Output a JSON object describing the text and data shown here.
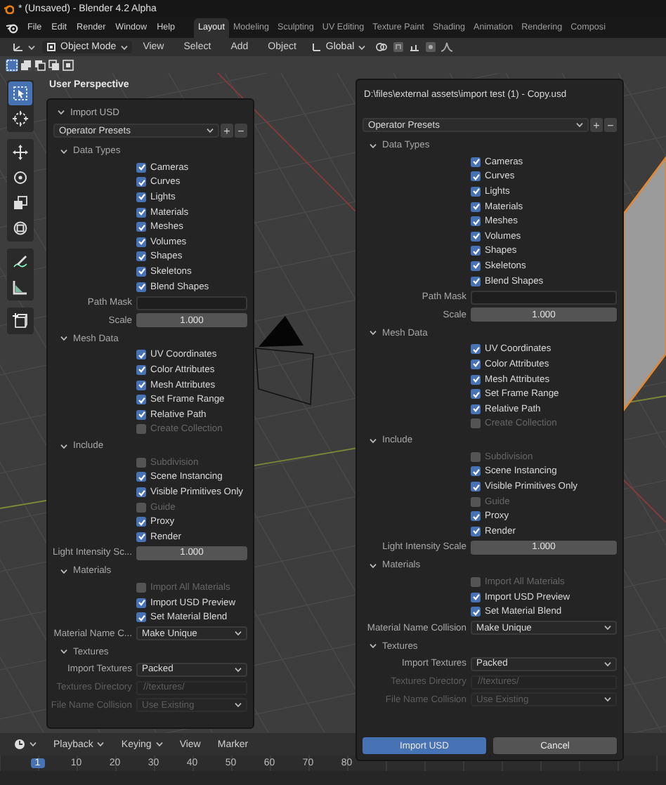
{
  "title_bar": {
    "title": "* (Unsaved) - Blender 4.2 Alpha"
  },
  "menu": [
    "File",
    "Edit",
    "Render",
    "Window",
    "Help"
  ],
  "workspaces": [
    {
      "label": "Layout",
      "selected": true
    },
    {
      "label": "Modeling",
      "selected": false
    },
    {
      "label": "Sculpting",
      "selected": false
    },
    {
      "label": "UV Editing",
      "selected": false
    },
    {
      "label": "Texture Paint",
      "selected": false
    },
    {
      "label": "Shading",
      "selected": false
    },
    {
      "label": "Animation",
      "selected": false
    },
    {
      "label": "Rendering",
      "selected": false
    },
    {
      "label": "Composi",
      "selected": false
    }
  ],
  "header": {
    "mode": "Object Mode",
    "menus": [
      "View",
      "Select",
      "Add",
      "Object"
    ],
    "orientation": "Global"
  },
  "select_modes": [
    {
      "kind": "new",
      "selected": true
    },
    {
      "kind": "extend",
      "selected": false
    },
    {
      "kind": "subtract",
      "selected": false
    },
    {
      "kind": "invert",
      "selected": false
    },
    {
      "kind": "intersect",
      "selected": false
    }
  ],
  "viewport": {
    "label": "User Perspective"
  },
  "tools": [
    {
      "kind": "select",
      "selected": true
    },
    {
      "kind": "cursor",
      "selected": false
    },
    {
      "kind": "move",
      "selected": false
    },
    {
      "kind": "rotate",
      "selected": false
    },
    {
      "kind": "scale",
      "selected": false
    },
    {
      "kind": "transform",
      "selected": false
    },
    {
      "kind": "annotate",
      "selected": false
    },
    {
      "kind": "measure",
      "selected": false
    },
    {
      "kind": "add-cube",
      "selected": false
    }
  ],
  "panels": [
    {
      "header": {
        "kind": "collapsible",
        "text": "Import USD",
        "expanded": true
      },
      "presets": "Operator Presets",
      "preset_buttons": [
        "+",
        "−"
      ],
      "sections": [
        {
          "title": "Data Types",
          "expanded": true,
          "rows": [
            {
              "kind": "check",
              "label": "Cameras",
              "checked": true,
              "disabled": false
            },
            {
              "kind": "check",
              "label": "Curves",
              "checked": true,
              "disabled": false
            },
            {
              "kind": "check",
              "label": "Lights",
              "checked": true,
              "disabled": false
            },
            {
              "kind": "check",
              "label": "Materials",
              "checked": true,
              "disabled": false
            },
            {
              "kind": "check",
              "label": "Meshes",
              "checked": true,
              "disabled": false
            },
            {
              "kind": "check",
              "label": "Volumes",
              "checked": true,
              "disabled": false
            },
            {
              "kind": "check",
              "label": "Shapes",
              "checked": true,
              "disabled": false
            },
            {
              "kind": "check",
              "label": "Skeletons",
              "checked": true,
              "disabled": false
            },
            {
              "kind": "check",
              "label": "Blend Shapes",
              "checked": true,
              "disabled": false
            },
            {
              "kind": "field",
              "label": "Path Mask",
              "disabled": false
            },
            {
              "kind": "number",
              "label": "Scale",
              "value": "1.000",
              "disabled": false
            }
          ]
        },
        {
          "title": "Mesh Data",
          "expanded": true,
          "rows": [
            {
              "kind": "check",
              "label": "UV Coordinates",
              "checked": true,
              "disabled": false
            },
            {
              "kind": "check",
              "label": "Color Attributes",
              "checked": true,
              "disabled": false
            },
            {
              "kind": "check",
              "label": "Mesh Attributes",
              "checked": true,
              "disabled": false
            },
            {
              "kind": "check",
              "label": "Set Frame Range",
              "checked": true,
              "disabled": false
            },
            {
              "kind": "check",
              "label": "Relative Path",
              "checked": true,
              "disabled": false
            },
            {
              "kind": "check",
              "label": "Create Collection",
              "checked": false,
              "disabled": true
            }
          ]
        },
        {
          "title": "Include",
          "expanded": true,
          "rows": [
            {
              "kind": "check",
              "label": "Subdivision",
              "checked": false,
              "disabled": true
            },
            {
              "kind": "check",
              "label": "Scene Instancing",
              "checked": true,
              "disabled": false
            },
            {
              "kind": "check",
              "label": "Visible Primitives Only",
              "checked": true,
              "disabled": false
            },
            {
              "kind": "check",
              "label": "Guide",
              "checked": false,
              "disabled": true
            },
            {
              "kind": "check",
              "label": "Proxy",
              "checked": true,
              "disabled": false
            },
            {
              "kind": "check",
              "label": "Render",
              "checked": true,
              "disabled": false
            },
            {
              "kind": "number",
              "label": "Light Intensity Sc...",
              "value": "1.000",
              "disabled": false
            }
          ]
        },
        {
          "title": "Materials",
          "expanded": true,
          "rows": [
            {
              "kind": "check",
              "label": "Import All Materials",
              "checked": false,
              "disabled": true
            },
            {
              "kind": "check",
              "label": "Import USD Preview",
              "checked": true,
              "disabled": false
            },
            {
              "kind": "check",
              "label": "Set Material Blend",
              "checked": true,
              "disabled": false
            },
            {
              "kind": "dropdown",
              "label": "Material Name C...",
              "value": "Make Unique",
              "disabled": false
            }
          ]
        },
        {
          "title": "Textures",
          "expanded": true,
          "rows": [
            {
              "kind": "dropdown",
              "label": "Import Textures",
              "value": "Packed",
              "disabled": false
            },
            {
              "kind": "field",
              "label": "Textures Directory",
              "value": "//textures/",
              "disabled": true
            },
            {
              "kind": "dropdown",
              "label": "File Name Collision",
              "value": "Use Existing",
              "disabled": true
            }
          ]
        }
      ]
    },
    {
      "header": {
        "kind": "title",
        "text": "D:\\files\\external assets\\import test (1) - Copy.usd"
      },
      "presets": "Operator Presets",
      "preset_buttons": [
        "+",
        "−"
      ],
      "sections": [
        {
          "title": "Data Types",
          "expanded": true,
          "rows": [
            {
              "kind": "check",
              "label": "Cameras",
              "checked": true,
              "disabled": false
            },
            {
              "kind": "check",
              "label": "Curves",
              "checked": true,
              "disabled": false
            },
            {
              "kind": "check",
              "label": "Lights",
              "checked": true,
              "disabled": false
            },
            {
              "kind": "check",
              "label": "Materials",
              "checked": true,
              "disabled": false
            },
            {
              "kind": "check",
              "label": "Meshes",
              "checked": true,
              "disabled": false
            },
            {
              "kind": "check",
              "label": "Volumes",
              "checked": true,
              "disabled": false
            },
            {
              "kind": "check",
              "label": "Shapes",
              "checked": true,
              "disabled": false
            },
            {
              "kind": "check",
              "label": "Skeletons",
              "checked": true,
              "disabled": false
            },
            {
              "kind": "check",
              "label": "Blend Shapes",
              "checked": true,
              "disabled": false
            },
            {
              "kind": "field",
              "label": "Path Mask",
              "disabled": false
            },
            {
              "kind": "number",
              "label": "Scale",
              "value": "1.000",
              "disabled": false
            }
          ]
        },
        {
          "title": "Mesh Data",
          "expanded": true,
          "rows": [
            {
              "kind": "check",
              "label": "UV Coordinates",
              "checked": true,
              "disabled": false
            },
            {
              "kind": "check",
              "label": "Color Attributes",
              "checked": true,
              "disabled": false
            },
            {
              "kind": "check",
              "label": "Mesh Attributes",
              "checked": true,
              "disabled": false
            },
            {
              "kind": "check",
              "label": "Set Frame Range",
              "checked": true,
              "disabled": false
            },
            {
              "kind": "check",
              "label": "Relative Path",
              "checked": true,
              "disabled": false
            },
            {
              "kind": "check",
              "label": "Create Collection",
              "checked": false,
              "disabled": true
            }
          ]
        },
        {
          "title": "Include",
          "expanded": true,
          "rows": [
            {
              "kind": "check",
              "label": "Subdivision",
              "checked": false,
              "disabled": true
            },
            {
              "kind": "check",
              "label": "Scene Instancing",
              "checked": true,
              "disabled": false
            },
            {
              "kind": "check",
              "label": "Visible Primitives Only",
              "checked": true,
              "disabled": false
            },
            {
              "kind": "check",
              "label": "Guide",
              "checked": false,
              "disabled": true
            },
            {
              "kind": "check",
              "label": "Proxy",
              "checked": true,
              "disabled": false
            },
            {
              "kind": "check",
              "label": "Render",
              "checked": true,
              "disabled": false
            },
            {
              "kind": "number",
              "label": "Light Intensity Scale",
              "value": "1.000",
              "disabled": false
            }
          ]
        },
        {
          "title": "Materials",
          "expanded": true,
          "rows": [
            {
              "kind": "check",
              "label": "Import All Materials",
              "checked": false,
              "disabled": true
            },
            {
              "kind": "check",
              "label": "Import USD Preview",
              "checked": true,
              "disabled": false
            },
            {
              "kind": "check",
              "label": "Set Material Blend",
              "checked": true,
              "disabled": false
            },
            {
              "kind": "dropdown",
              "label": "Material Name Collision",
              "value": "Make Unique",
              "disabled": false
            }
          ]
        },
        {
          "title": "Textures",
          "expanded": true,
          "rows": [
            {
              "kind": "dropdown",
              "label": "Import Textures",
              "value": "Packed",
              "disabled": false
            },
            {
              "kind": "field",
              "label": "Textures Directory",
              "value": "//textures/",
              "disabled": true
            },
            {
              "kind": "dropdown",
              "label": "File Name Collision",
              "value": "Use Existing",
              "disabled": true
            }
          ]
        }
      ],
      "buttons": [
        {
          "label": "Import USD",
          "primary": true
        },
        {
          "label": "Cancel",
          "primary": false
        }
      ]
    }
  ],
  "timeline": {
    "menus": [
      {
        "label": "Playback",
        "dropdown": true
      },
      {
        "label": "Keying",
        "dropdown": true
      },
      {
        "label": "View",
        "dropdown": false
      },
      {
        "label": "Marker",
        "dropdown": false
      }
    ],
    "frames": [
      {
        "label": "1",
        "selected": true
      },
      {
        "label": "10",
        "selected": false
      },
      {
        "label": "20",
        "selected": false
      },
      {
        "label": "30",
        "selected": false
      },
      {
        "label": "40",
        "selected": false
      },
      {
        "label": "50",
        "selected": false
      },
      {
        "label": "60",
        "selected": false
      },
      {
        "label": "70",
        "selected": false
      },
      {
        "label": "80",
        "selected": false
      }
    ]
  }
}
